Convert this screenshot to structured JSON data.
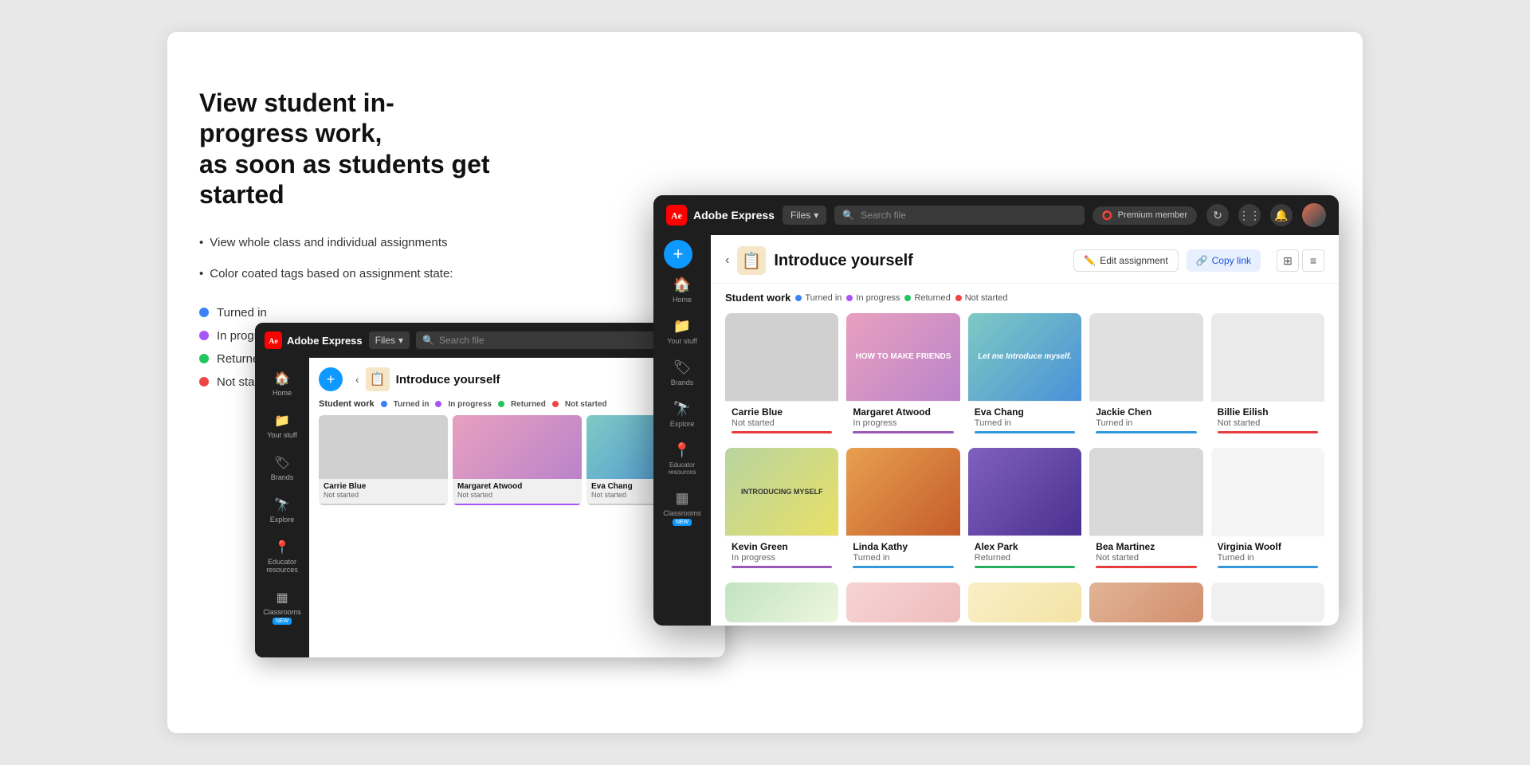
{
  "page": {
    "heading_line1": "View student in-progress work,",
    "heading_line2": "as soon as students get started"
  },
  "bullets": [
    "View whole class and individual assignments",
    "Color coated tags based on assignment state:"
  ],
  "legend": [
    {
      "label": "Turned in",
      "color": "#3b82f6"
    },
    {
      "label": "In progress",
      "color": "#a855f7"
    },
    {
      "label": "Returned",
      "color": "#22c55e"
    },
    {
      "label": "Not started",
      "color": "#ef4444"
    }
  ],
  "app": {
    "name": "Adobe Express",
    "files_dropdown": "Files",
    "search_placeholder": "Search file",
    "premium_label": "Premium member",
    "assignment_title": "Introduce yourself",
    "edit_btn": "Edit assignment",
    "copy_btn": "Copy link",
    "student_work_label": "Student work",
    "status_labels": [
      "Turned in",
      "In progress",
      "Returned",
      "Not started"
    ],
    "plus_btn": "+",
    "back_btn": "‹",
    "sidebar_items": [
      {
        "icon": "🏠",
        "label": "Home"
      },
      {
        "icon": "📁",
        "label": "Your stuff"
      },
      {
        "icon": "🏷",
        "label": "Brands"
      },
      {
        "icon": "🔭",
        "label": "Explore"
      },
      {
        "icon": "📍",
        "label": "Educator resources"
      },
      {
        "icon": "▦",
        "label": "Classrooms",
        "badge": "NEW"
      }
    ],
    "students_row1": [
      {
        "name": "Carrie Blue",
        "status": "Not started",
        "status_type": "not-started",
        "thumb": "gray"
      },
      {
        "name": "Margaret Atwood",
        "status": "In progress",
        "status_type": "in-progress",
        "thumb": "pink-purple"
      },
      {
        "name": "Eva Chang",
        "status": "Turned in",
        "status_type": "turned-in",
        "thumb": "teal-blue"
      },
      {
        "name": "Jackie Chen",
        "status": "Turned in",
        "status_type": "turned-in",
        "thumb": "light-gray"
      },
      {
        "name": "Billie Eilish",
        "status": "Not started",
        "status_type": "not-started",
        "thumb": "very-light"
      }
    ],
    "students_row2": [
      {
        "name": "Kevin Green",
        "status": "In progress",
        "status_type": "in-progress",
        "thumb": "green-yellow"
      },
      {
        "name": "Linda Kathy",
        "status": "Turned in",
        "status_type": "turned-in",
        "thumb": "orange-warm"
      },
      {
        "name": "Alex Park",
        "status": "Returned",
        "status_type": "returned",
        "thumb": "purple-dark"
      },
      {
        "name": "Bea Martinez",
        "status": "Not started",
        "status_type": "not-started",
        "thumb": "light-gray2"
      },
      {
        "name": "Virginia Woolf",
        "status": "Turned in",
        "status_type": "turned-in",
        "thumb": "sketch"
      }
    ]
  }
}
